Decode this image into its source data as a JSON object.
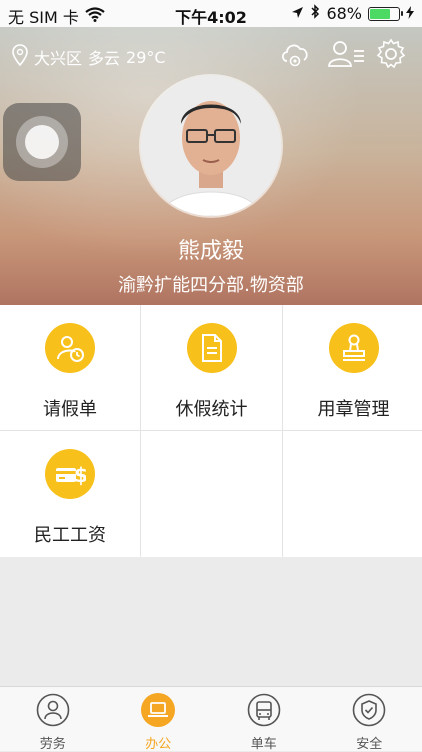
{
  "status_bar": {
    "carrier": "无 SIM 卡",
    "time": "下午4:02",
    "battery": "68%",
    "battery_level": 0.68
  },
  "header": {
    "location": "大兴区",
    "weather": "多云",
    "temperature": "29°C",
    "icons": [
      "cloud-camera-icon",
      "user-list-icon",
      "settings-gear-icon"
    ]
  },
  "profile": {
    "name": "熊成毅",
    "department": "渝黔扩能四分部.物资部"
  },
  "menu": {
    "items": [
      {
        "label": "请假单",
        "icon": "user-clock-icon"
      },
      {
        "label": "休假统计",
        "icon": "document-icon"
      },
      {
        "label": "用章管理",
        "icon": "stamp-icon"
      },
      {
        "label": "民工工资",
        "icon": "salary-card-icon"
      }
    ]
  },
  "tabs": [
    {
      "label": "劳务",
      "icon": "person-icon",
      "active": false
    },
    {
      "label": "办公",
      "icon": "laptop-icon",
      "active": true
    },
    {
      "label": "单车",
      "icon": "bus-icon",
      "active": false
    },
    {
      "label": "安全",
      "icon": "shield-icon",
      "active": false
    }
  ],
  "colors": {
    "accent": "#f8c01a",
    "active_tab": "#f5a623"
  }
}
